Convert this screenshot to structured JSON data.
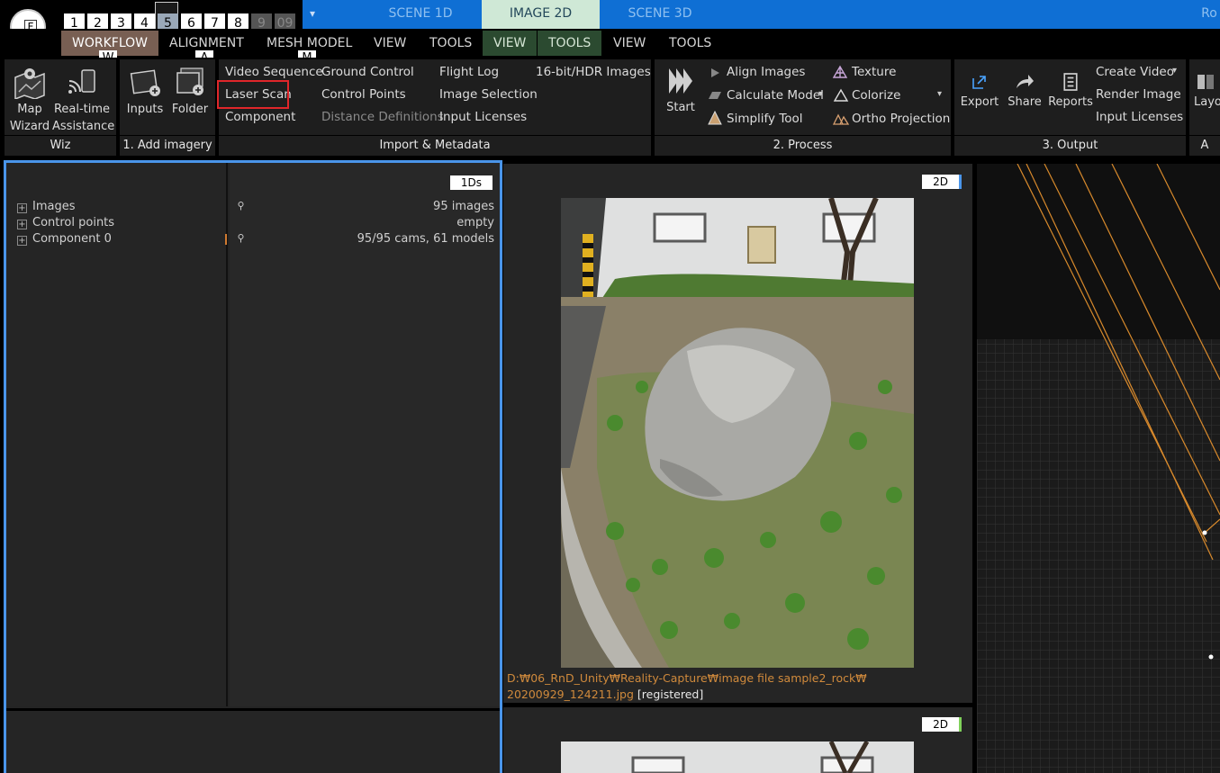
{
  "layouts": {
    "numbers": [
      "1",
      "2",
      "3",
      "4",
      "5",
      "6",
      "7",
      "8",
      "9",
      "09"
    ]
  },
  "logo_letter": "F",
  "scene_tabs": {
    "dropdown_glyph": "▾",
    "items": [
      "SCENE 1D",
      "IMAGE 2D",
      "SCENE 3D"
    ],
    "active": "IMAGE 2D",
    "truncated_right": "Ro"
  },
  "menu": {
    "items": [
      "WORKFLOW",
      "ALIGNMENT",
      "MESH MODEL",
      "VIEW",
      "TOOLS",
      "VIEW",
      "TOOLS",
      "VIEW",
      "TOOLS"
    ],
    "hotkeys": [
      "W",
      "A",
      "M"
    ]
  },
  "ribbon": {
    "wiz": {
      "label": "Wiz",
      "map_wizard": "Map\nWizard",
      "map_line1": "Map",
      "map_line2": "Wizard",
      "rt_line1": "Real-time",
      "rt_line2": "Assistance"
    },
    "add_imagery": {
      "label": "1. Add imagery",
      "inputs": "Inputs",
      "folder": "Folder"
    },
    "import": {
      "label": "Import & Metadata",
      "col1": [
        "Video Sequence",
        "Laser Scan",
        "Component"
      ],
      "col2": [
        "Ground Control",
        "Control Points",
        "Distance Definitions"
      ],
      "col3": [
        "Flight Log",
        "Image Selection",
        "Input Licenses"
      ],
      "col4": [
        "16-bit/HDR Images"
      ]
    },
    "process": {
      "label": "2. Process",
      "start": "Start",
      "col1": [
        "Align Images",
        "Calculate Model",
        "Simplify Tool"
      ],
      "col2": [
        "Texture",
        "Colorize",
        "Ortho Projection"
      ]
    },
    "output": {
      "label": "3. Output",
      "export": "Export",
      "share": "Share",
      "reports": "Reports",
      "col": [
        "Create Video",
        "Render Image",
        "Input Licenses"
      ]
    },
    "truncated": {
      "layout": "Layo",
      "label": "A"
    }
  },
  "panel_1d": {
    "tag": "1Ds",
    "rows": [
      {
        "name": "Images",
        "value": "95 images"
      },
      {
        "name": "Control points",
        "value": "empty"
      },
      {
        "name": "Component 0",
        "value": "95/95 cams, 61 models"
      }
    ]
  },
  "panel_2d": {
    "tag": "2D",
    "path_line1": "D:₩06_RnD_Unity₩Reality-Capture₩image file sample2_rock₩",
    "path_line2": "20200929_124211.jpg",
    "status": "[registered]"
  },
  "panel_2d_b": {
    "tag": "2D"
  },
  "colors": {
    "accent_blue": "#0f6fd4",
    "active_tab": "#cfe8d6",
    "workflow_tab": "#785f53",
    "highlight_red": "#e0262a",
    "selection_border": "#4a95ea",
    "path_orange": "#d08a3c"
  }
}
